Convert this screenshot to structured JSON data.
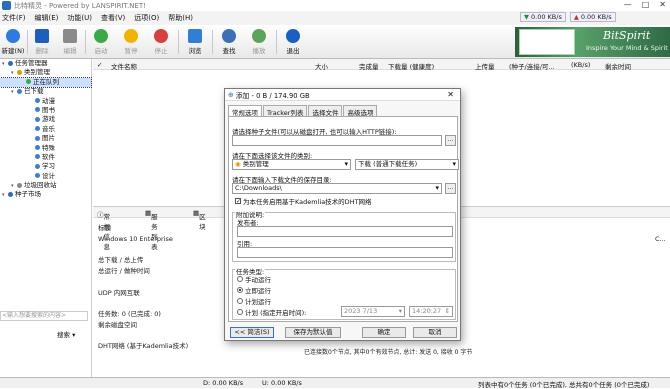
{
  "window": {
    "title": "比特精灵 - Powered by LANSPIRIT.NET!",
    "min": "—",
    "max": "□",
    "close": "✕"
  },
  "menu": [
    "文件(F)",
    "编辑(E)",
    "功能(U)",
    "查看(V)",
    "远项(O)",
    "帮助(H)"
  ],
  "speed": {
    "down": "0.00 KB/s",
    "up": "0.00 KB/s"
  },
  "toolbar": [
    {
      "label": "新建(N)",
      "icon": "new-icon",
      "color": "#2c7be0"
    },
    {
      "label": "删除",
      "icon": "delete-icon",
      "color": "#1d5fbf"
    },
    {
      "label": "编辑",
      "icon": "edit-icon",
      "color": "#8a8a8a"
    },
    {
      "label": "启动",
      "icon": "start-icon",
      "color": "#3aaa46"
    },
    {
      "label": "暂停",
      "icon": "pause-icon",
      "color": "#f0b400"
    },
    {
      "label": "停止",
      "icon": "stop-icon",
      "color": "#d84040"
    },
    {
      "label": "浏览",
      "icon": "browse-icon",
      "color": "#2f7fd6"
    },
    {
      "label": "查找",
      "icon": "find-icon",
      "color": "#3b6fb8"
    },
    {
      "label": "播放",
      "icon": "play-icon",
      "color": "#5ca35c"
    },
    {
      "label": "退出",
      "icon": "exit-icon",
      "color": "#1a5fc2"
    }
  ],
  "brand": {
    "name": "BitSpirit",
    "tagline": "Inspire Your Mind & Spirit"
  },
  "tree": [
    {
      "label": "任务管理器",
      "indent": 0,
      "color": "#2a6cc0"
    },
    {
      "label": "类别管理",
      "indent": 1,
      "color": "#d99b00"
    },
    {
      "label": "正在队列",
      "indent": 2,
      "color": "#3aaa46",
      "selected": true
    },
    {
      "label": "已下载",
      "indent": 1,
      "color": "#3a7fd0"
    },
    {
      "label": "动漫",
      "indent": 3,
      "color": "#3a7fd0"
    },
    {
      "label": "图书",
      "indent": 3,
      "color": "#3a7fd0"
    },
    {
      "label": "游戏",
      "indent": 3,
      "color": "#3a7fd0"
    },
    {
      "label": "音乐",
      "indent": 3,
      "color": "#3a7fd0"
    },
    {
      "label": "图片",
      "indent": 3,
      "color": "#3a7fd0"
    },
    {
      "label": "特殊",
      "indent": 3,
      "color": "#3a7fd0"
    },
    {
      "label": "软件",
      "indent": 3,
      "color": "#3a7fd0"
    },
    {
      "label": "学习",
      "indent": 3,
      "color": "#3a7fd0"
    },
    {
      "label": "设计",
      "indent": 3,
      "color": "#3a7fd0"
    },
    {
      "label": "垃圾回收站",
      "indent": 1,
      "color": "#888888"
    },
    {
      "label": "种子市场",
      "indent": 0,
      "color": "#2a6cc0"
    }
  ],
  "left_input_placeholder": "<输入想要搜索的内容>",
  "left_search": "搜索 ▾",
  "list_headers": [
    "文件名称",
    "大小",
    "完成量",
    "下载量 (健康度)",
    "上传量",
    "(种子/连接/可...",
    "(KB/s)",
    "剩余时间"
  ],
  "bottom_tabs": [
    "常规信息",
    "服务列表",
    "区块"
  ],
  "info": [
    {
      "label": "标题",
      "value": ""
    },
    {
      "label": "Windows 10 Enterprise",
      "value": ""
    },
    {
      "label": "总下载 / 总上传",
      "value": ""
    },
    {
      "label": "总运行 / 做种时间",
      "value": ""
    },
    {
      "label": "UDP 内网互联",
      "value": ""
    },
    {
      "label": "任务数: 0 (已完成: 0)",
      "value": ""
    },
    {
      "label": "剩余磁盘空间",
      "value": ""
    },
    {
      "label": "DHT网络 (基于Kademlia技术)",
      "value": "已连接数0个节点, 其中0个有效节点, 总计: 发送 0, 接收 0 字节"
    }
  ],
  "info_right": "C...",
  "status": {
    "down": "D: 0.00 KB/s",
    "up": "U: 0.00 KB/s",
    "right": "列表中有0个任务 (0个已完成), 总共有0个任务 (0个已完成)"
  },
  "dialog": {
    "title": "添加 - 0 B / 174.90 GB",
    "close": "✕",
    "tabs": [
      "常规选项",
      "Tracker列表",
      "选择文件",
      "高级选项"
    ],
    "torrent_label": "请选择种子文件(可以从磁盘打开, 也可以输入HTTP链接):",
    "torrent_value": "",
    "category_label": "请在下面选择该文件的类别:",
    "category_value": "类别管理",
    "mode_value": "下载 (普通下载任务)",
    "savepath_label": "请在下面输入下载文件的保存目录:",
    "savepath_value": "C:\\Downloads\\",
    "dht_check": "为本任务启用基于Kademlia技术的DHT网络",
    "comment_group": "附加说明:",
    "publisher_label": "发布者:",
    "publisher_value": "",
    "quote_label": "引用:",
    "quote_value": "",
    "task_type_label": "任务类型:",
    "radio_manual": "手动运行",
    "radio_now": "立即运行",
    "radio_plan": "计划运行",
    "radio_timed": "计划 (指定开启时间):",
    "date_value": "2023   7/13",
    "time_value": "14:20:27",
    "btn_simple": "<< 简洁(S)",
    "btn_default": "保存为默认值",
    "btn_ok": "确定",
    "btn_cancel": "取消"
  }
}
